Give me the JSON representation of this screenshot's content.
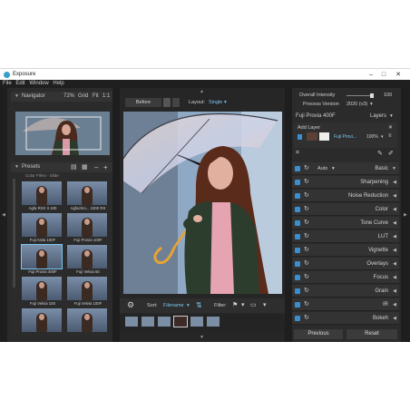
{
  "window": {
    "title": "Exposure"
  },
  "menu": [
    "File",
    "Edit",
    "Window",
    "Help"
  ],
  "navigator": {
    "title": "Navigator",
    "zoom": "72%",
    "grid": "Grid",
    "fit": "Fit",
    "one_to_one": "1:1"
  },
  "presets": {
    "title": "Presets",
    "group": "Color Films - Slide",
    "items": [
      {
        "label": "Agfa RSX II 100",
        "style": "color"
      },
      {
        "label": "Agfachro... 1000 RS",
        "style": "color"
      },
      {
        "label": "Fuji Astia 100F",
        "style": "color"
      },
      {
        "label": "Fuji Provia 100F",
        "style": "color"
      },
      {
        "label": "Fuji Provia 400F",
        "style": "color",
        "selected": true
      },
      {
        "label": "Fuji Velvia 50",
        "style": "color"
      },
      {
        "label": "Fuji Velvia 100",
        "style": "color"
      },
      {
        "label": "Fuji Velvia 100F",
        "style": "color"
      },
      {
        "label": "",
        "style": "color"
      },
      {
        "label": "",
        "style": "color"
      }
    ]
  },
  "toolbar": {
    "before": "Before",
    "layout_label": "Layout:",
    "layout_value": "Single"
  },
  "bottombar": {
    "sort_label": "Sort:",
    "sort_value": "Filename",
    "filter_label": "Filter:"
  },
  "adjust": {
    "overall_intensity_label": "Overall Intensity",
    "overall_intensity_value": "100",
    "process_version_label": "Process Version",
    "process_version_value": "2020 (v3)",
    "preset_name": "Fuji Provia 400F",
    "layers_label": "Layers",
    "add_layer": "Add Layer",
    "layer_name": "Fuji Provi...",
    "layer_opacity": "100%",
    "auto_label": "Auto",
    "panels": [
      "Basic",
      "Sharpening",
      "Noise Reduction",
      "Color",
      "Tone Curve",
      "LUT",
      "Vignette",
      "Overlays",
      "Focus",
      "Grain",
      "IR",
      "Bokeh"
    ],
    "previous": "Previous",
    "reset": "Reset"
  },
  "colors": {
    "accent": "#3a8fd0",
    "selection": "#79c7f2",
    "panel": "#2b2b2b"
  }
}
